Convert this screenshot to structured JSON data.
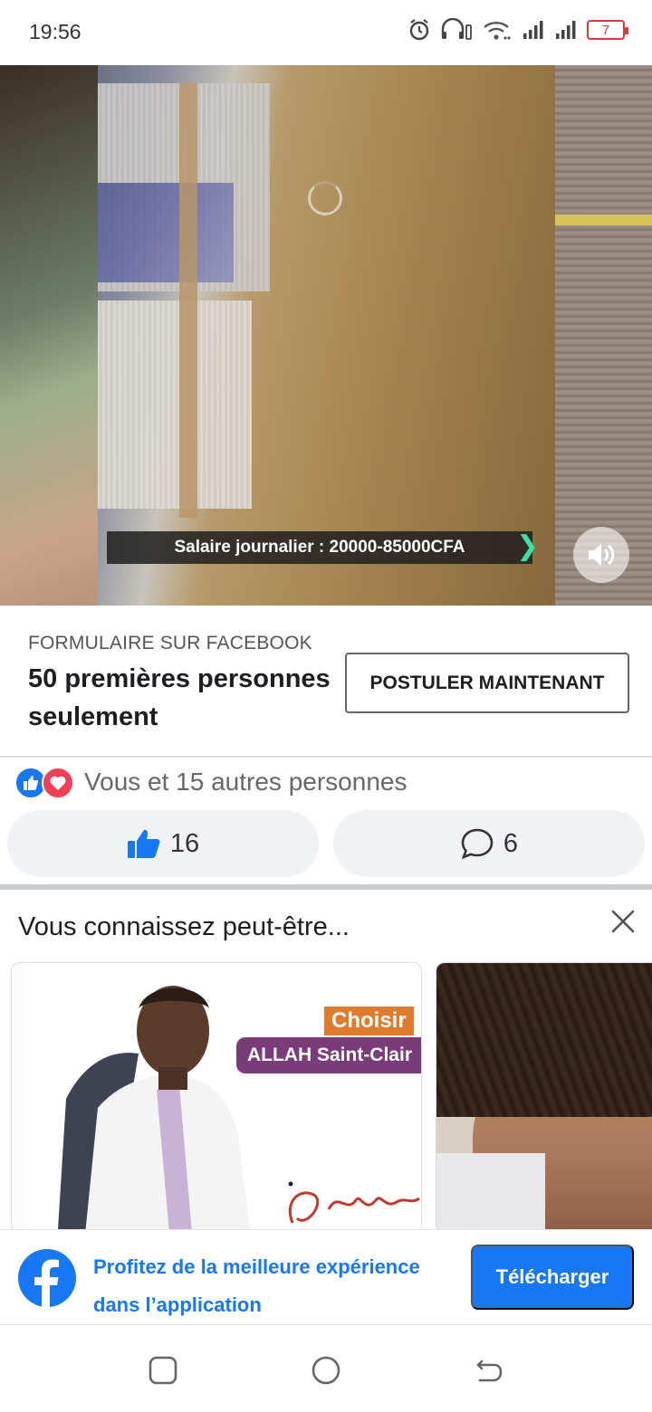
{
  "status_bar": {
    "time": "19:56",
    "battery_level": "7",
    "icons": [
      "alarm-icon",
      "headset-icon",
      "wifi-icon",
      "signal-icon",
      "signal-icon",
      "battery-icon"
    ]
  },
  "video": {
    "caption": "Salaire journalier : 20000-85000CFA",
    "volume_icon": "speaker-icon"
  },
  "ad": {
    "source": "FORMULAIRE SUR FACEBOOK",
    "headline": "50 premières personnes seulement",
    "cta_label": "POSTULER MAINTENANT"
  },
  "reactions": {
    "summary": "Vous et 15 autres personnes",
    "like_count": "16",
    "comment_count": "6"
  },
  "people_you_may_know": {
    "title": "Vous connaissez peut-être...",
    "card1": {
      "badge_top": "Choisir",
      "badge_name": "ALLAH Saint-Clair"
    }
  },
  "app_banner": {
    "promo_line1": "Profitez de la meilleure expérience",
    "promo_line2": "dans l’application",
    "download_label": "Télécharger"
  },
  "colors": {
    "facebook_blue": "#1877f2",
    "love_red": "#f33e58",
    "pill_bg": "#f0f2f5",
    "battery_red": "#d63a3a"
  }
}
